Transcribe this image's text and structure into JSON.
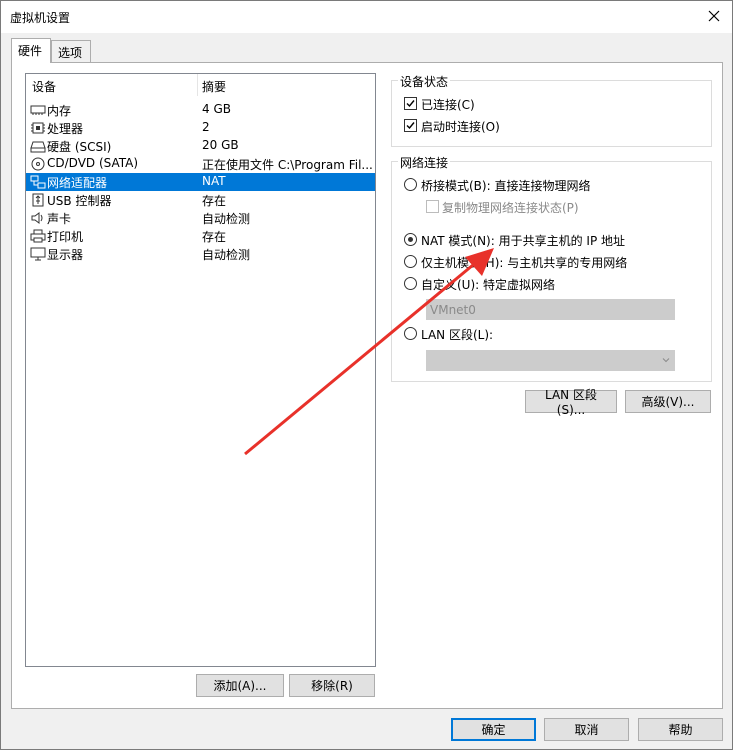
{
  "window": {
    "title": "虚拟机设置"
  },
  "tabs": [
    {
      "label": "硬件",
      "active": true
    },
    {
      "label": "选项",
      "active": false
    }
  ],
  "device_list": {
    "columns": [
      "设备",
      "摘要"
    ],
    "rows": [
      {
        "icon": "memory-icon",
        "name": "内存",
        "summary": "4 GB",
        "selected": false
      },
      {
        "icon": "cpu-icon",
        "name": "处理器",
        "summary": "2",
        "selected": false
      },
      {
        "icon": "hard-disk-icon",
        "name": "硬盘 (SCSI)",
        "summary": "20 GB",
        "selected": false
      },
      {
        "icon": "cd-dvd-icon",
        "name": "CD/DVD (SATA)",
        "summary": "正在使用文件 C:\\Program Fil...",
        "selected": false
      },
      {
        "icon": "network-adapter-icon",
        "name": "网络适配器",
        "summary": "NAT",
        "selected": true
      },
      {
        "icon": "usb-icon",
        "name": "USB 控制器",
        "summary": "存在",
        "selected": false
      },
      {
        "icon": "speaker-icon",
        "name": "声卡",
        "summary": "自动检测",
        "selected": false
      },
      {
        "icon": "printer-icon",
        "name": "打印机",
        "summary": "存在",
        "selected": false
      },
      {
        "icon": "display-icon",
        "name": "显示器",
        "summary": "自动检测",
        "selected": false
      }
    ]
  },
  "list_buttons": {
    "add": "添加(A)...",
    "remove": "移除(R)"
  },
  "device_status": {
    "title": "设备状态",
    "connected": {
      "label": "已连接(C)",
      "checked": true
    },
    "connect_at_power_on": {
      "label": "启动时连接(O)",
      "checked": true
    }
  },
  "network_connection": {
    "title": "网络连接",
    "bridged": {
      "label": "桥接模式(B): 直接连接物理网络",
      "selected": false
    },
    "replicate": {
      "label": "复制物理网络连接状态(P)",
      "checked": false,
      "disabled": true
    },
    "nat": {
      "label": "NAT 模式(N): 用于共享主机的 IP 地址",
      "selected": true
    },
    "host_only": {
      "label": "仅主机模式(H): 与主机共享的专用网络",
      "selected": false
    },
    "custom": {
      "label": "自定义(U): 特定虚拟网络",
      "selected": false,
      "value": "VMnet0"
    },
    "lan_segment": {
      "label": "LAN 区段(L):",
      "selected": false,
      "value": ""
    }
  },
  "network_buttons": {
    "lan_segments": "LAN 区段(S)...",
    "advanced": "高级(V)..."
  },
  "dialog_buttons": {
    "ok": "确定",
    "cancel": "取消",
    "help": "帮助"
  },
  "annotation": {
    "color": "#e8312a"
  }
}
